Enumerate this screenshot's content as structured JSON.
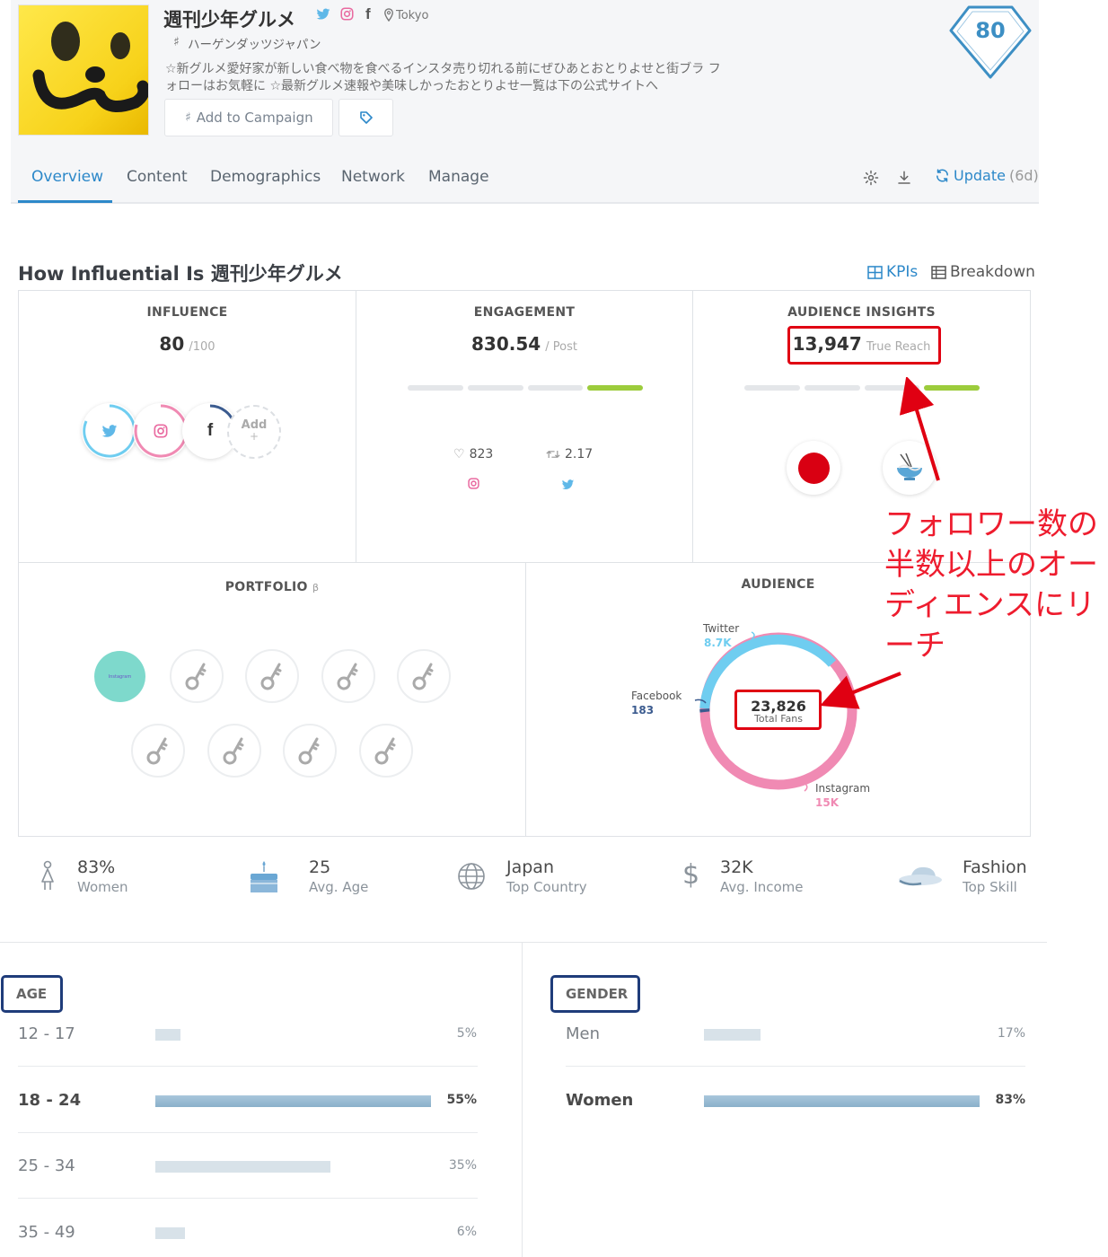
{
  "profile": {
    "name": "週刊少年グルメ",
    "location": "Tokyo",
    "handle": "ハーゲンダッツジャパン",
    "bio": "☆新グルメ愛好家が新しい食べ物を食べるインスタ売り切れる前にぜひあとおとりよせと街ブラ フォローはお気軽に ☆最新グルメ速報や美味しかったおとりよせ一覧は下の公式サイトへ",
    "score": "80",
    "icons": [
      "twitter-icon",
      "instagram-icon",
      "facebook-icon",
      "location-pin-icon"
    ]
  },
  "actions": {
    "add_campaign": "Add to Campaign"
  },
  "tabs": [
    "Overview",
    "Content",
    "Demographics",
    "Network",
    "Manage"
  ],
  "toolbar": {
    "update_label": "Update",
    "update_age": "(6d)"
  },
  "section": {
    "title": "How Influential Is 週刊少年グルメ",
    "kpis_label": "KPIs",
    "breakdown_label": "Breakdown"
  },
  "influence": {
    "title": "INFLUENCE",
    "value": "80",
    "unit": "/100",
    "add_label": "Add",
    "add_plus": "+"
  },
  "engagement": {
    "title": "ENGAGEMENT",
    "value": "830.54",
    "unit": "/ Post",
    "level": 4,
    "likes": "823",
    "retweets": "2.17"
  },
  "audience_insights": {
    "title": "AUDIENCE INSIGHTS",
    "value": "13,947",
    "unit": "True Reach",
    "level": 4
  },
  "portfolio": {
    "title": "PORTFOLIO",
    "title_icon": "beta-icon",
    "first_item": "Instagram",
    "locked_count": 8
  },
  "audience": {
    "title": "AUDIENCE",
    "total": "23,826",
    "total_label": "Total Fans",
    "twitter_label": "Twitter",
    "twitter_value": "8.7K",
    "facebook_label": "Facebook",
    "facebook_value": "183",
    "instagram_label": "Instagram",
    "instagram_value": "15K",
    "colors": {
      "twitter": "#6fcdf0",
      "instagram": "#f08ab3",
      "facebook": "#3b5b8f"
    }
  },
  "annotation": {
    "note": "フォロワー数の半数以上のオーディエンスにリーチ"
  },
  "stats": [
    {
      "value": "83%",
      "label": "Women",
      "icon": "woman-icon"
    },
    {
      "value": "25",
      "label": "Avg. Age",
      "icon": "birthday-cake-icon"
    },
    {
      "value": "Japan",
      "label": "Top Country",
      "icon": "globe-icon"
    },
    {
      "value": "32K",
      "label": "Avg. Income",
      "icon": "dollar-icon"
    },
    {
      "value": "Fashion",
      "label": "Top Skill",
      "icon": "hat-icon"
    }
  ],
  "age": {
    "heading": "AGE",
    "rows": [
      {
        "label": "12 - 17",
        "pct": "5%",
        "fraction": 0.05
      },
      {
        "label": "18 - 24",
        "pct": "55%",
        "fraction": 0.55
      },
      {
        "label": "25 - 34",
        "pct": "35%",
        "fraction": 0.35
      },
      {
        "label": "35 - 49",
        "pct": "6%",
        "fraction": 0.06
      }
    ]
  },
  "gender": {
    "heading": "GENDER",
    "rows": [
      {
        "label": "Men",
        "pct": "17%",
        "fraction": 0.17
      },
      {
        "label": "Women",
        "pct": "83%",
        "fraction": 0.83
      }
    ]
  },
  "colors": {
    "accent": "#2c88c9",
    "annotation_red": "#e00012",
    "heading_box": "#1f3c7a",
    "engagement_green": "#9ccc3c"
  }
}
